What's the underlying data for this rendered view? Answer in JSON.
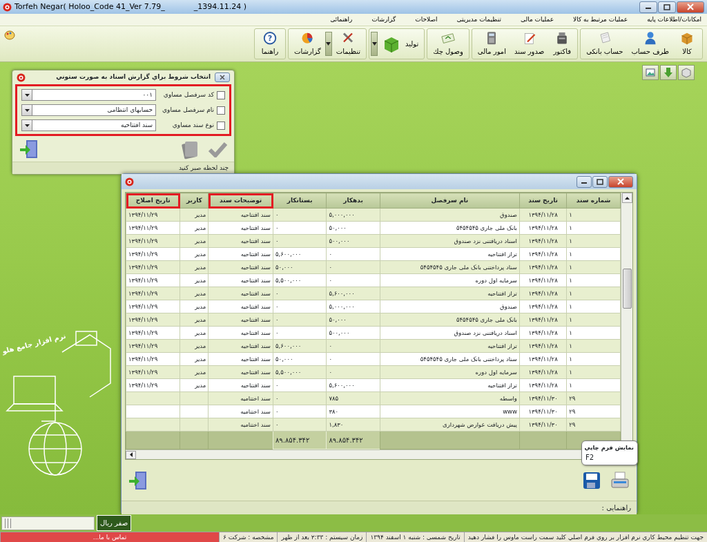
{
  "window": {
    "title": "Torfeh Negar( Holoo_Code 41_Ver 7.79_            _1394.11.24 )"
  },
  "menu": [
    "امکانات/اطلاعات پایه",
    "عملیات مرتبط به کالا",
    "عملیات مالی",
    "تنظیمات مدیریتی",
    "اصلاحات",
    "گزارشات",
    "راهنمائی"
  ],
  "toolbar": [
    [
      {
        "label": "کالا",
        "kind": "button"
      },
      {
        "label": "طرف حساب",
        "kind": "button"
      },
      {
        "label": "حساب بانکی",
        "kind": "button"
      }
    ],
    [
      {
        "label": "فاکتور",
        "kind": "button"
      },
      {
        "label": "صدور سند",
        "kind": "button"
      },
      {
        "label": "امور مالی",
        "kind": "button"
      }
    ],
    [
      {
        "label": "وصول چك",
        "kind": "button"
      }
    ],
    [
      {
        "label": "تولید",
        "kind": "dropdown"
      }
    ],
    [
      {
        "label": "تنظیمات",
        "kind": "dropdown"
      },
      {
        "label": "گزارشات",
        "kind": "button"
      }
    ],
    [
      {
        "label": "راهنما",
        "kind": "button",
        "glyph": "?"
      }
    ]
  ],
  "filter_dialog": {
    "title": "انتخاب شروط براي گزارش اسناد به صورت ستوني",
    "highlighted": true,
    "conditions": [
      {
        "label": "کد سرفصل مساوي",
        "checked": false,
        "value": "۰۰۱"
      },
      {
        "label": "نام سرفصل مساوي",
        "checked": false,
        "value": "حسابهاي انتظامی"
      },
      {
        "label": "نوع سند مساوي",
        "checked": false,
        "value": "سند افتتاحیه"
      }
    ],
    "hint": "چند لحظه صبر کنید"
  },
  "report_window": {
    "columns": [
      {
        "label": "شماره سند",
        "highlighted": false
      },
      {
        "label": "تاریخ سند",
        "highlighted": false
      },
      {
        "label": "نام سرفصل",
        "highlighted": false
      },
      {
        "label": "بدهکار",
        "highlighted": false
      },
      {
        "label": "بستانکار",
        "highlighted": false
      },
      {
        "label": "توضیحات سند",
        "highlighted": true
      },
      {
        "label": "کاربر",
        "highlighted": false
      },
      {
        "label": "تاریخ اصلاح",
        "highlighted": true
      }
    ],
    "rows": [
      [
        "۱",
        "۱۳۹۴/۱۱/۲۸",
        "صندوق",
        "۵,۰۰۰,۰۰۰",
        "۰",
        "سند افتتاحیه",
        "مدیر",
        "۱۳۹۴/۱۱/۲۹"
      ],
      [
        "۱",
        "۱۳۹۴/۱۱/۲۸",
        "بانک ملی جاری ۵۴۵۴۵۴۵",
        "۵۰,۰۰۰",
        "۰",
        "سند افتتاحیه",
        "مدیر",
        "۱۳۹۴/۱۱/۲۹"
      ],
      [
        "۱",
        "۱۳۹۴/۱۱/۲۸",
        "اسناد دریافتنی نزد صندوق",
        "۵۰۰,۰۰۰",
        "۰",
        "سند افتتاحیه",
        "مدیر",
        "۱۳۹۴/۱۱/۲۹"
      ],
      [
        "۱",
        "۱۳۹۴/۱۱/۲۸",
        "تراز افتتاحیه",
        "۰",
        "۵,۶۰۰,۰۰۰",
        "سند افتتاحیه",
        "مدیر",
        "۱۳۹۴/۱۱/۲۹"
      ],
      [
        "۱",
        "۱۳۹۴/۱۱/۲۸",
        "سناد پرداختنی بانک ملی جاری ۵۴۵۴۵۴۵",
        "۰",
        "۵۰,۰۰۰",
        "سند افتتاحیه",
        "مدیر",
        "۱۳۹۴/۱۱/۲۹"
      ],
      [
        "۱",
        "۱۳۹۴/۱۱/۲۸",
        "سرمایه اول دوره",
        "۰",
        "۵,۵۰۰,۰۰۰",
        "سند افتتاحیه",
        "مدیر",
        "۱۳۹۴/۱۱/۲۹"
      ],
      [
        "۱",
        "۱۳۹۴/۱۱/۲۸",
        "تراز افتتاحیه",
        "۵,۶۰۰,۰۰۰",
        "۰",
        "سند افتتاحیه",
        "مدیر",
        "۱۳۹۴/۱۱/۲۹"
      ],
      [
        "۱",
        "۱۳۹۴/۱۱/۲۸",
        "صندوق",
        "۵,۰۰۰,۰۰۰",
        "۰",
        "سند افتتاحیه",
        "مدیر",
        "۱۳۹۴/۱۱/۲۹"
      ],
      [
        "۱",
        "۱۳۹۴/۱۱/۲۸",
        "بانک ملی جاری ۵۴۵۴۵۴۵",
        "۵۰,۰۰۰",
        "۰",
        "سند افتتاحیه",
        "مدیر",
        "۱۳۹۴/۱۱/۲۹"
      ],
      [
        "۱",
        "۱۳۹۴/۱۱/۲۸",
        "اسناد دریافتنی نزد صندوق",
        "۵۰۰,۰۰۰",
        "۰",
        "سند افتتاحیه",
        "مدیر",
        "۱۳۹۴/۱۱/۲۹"
      ],
      [
        "۱",
        "۱۳۹۴/۱۱/۲۸",
        "تراز افتتاحیه",
        "۰",
        "۵,۶۰۰,۰۰۰",
        "سند افتتاحیه",
        "مدیر",
        "۱۳۹۴/۱۱/۲۹"
      ],
      [
        "۱",
        "۱۳۹۴/۱۱/۲۸",
        "سناد پرداختنی بانک ملی جاری ۵۴۵۴۵۴۵",
        "۰",
        "۵۰,۰۰۰",
        "سند افتتاحیه",
        "مدیر",
        "۱۳۹۴/۱۱/۲۹"
      ],
      [
        "۱",
        "۱۳۹۴/۱۱/۲۸",
        "سرمایه اول دوره",
        "۰",
        "۵,۵۰۰,۰۰۰",
        "سند افتتاحیه",
        "مدیر",
        "۱۳۹۴/۱۱/۲۹"
      ],
      [
        "۱",
        "۱۳۹۴/۱۱/۲۸",
        "تراز افتتاحیه",
        "۵,۶۰۰,۰۰۰",
        "۰",
        "سند افتتاحیه",
        "مدیر",
        "۱۳۹۴/۱۱/۲۹"
      ],
      [
        "۲۹",
        "۱۳۹۴/۱۱/۳۰",
        "واسطه",
        "۷۸۵",
        "۰",
        "سند اختتامیه",
        null,
        null
      ],
      [
        "۲۹",
        "۱۳۹۴/۱۱/۳۰",
        "www",
        "۳۸۰",
        "۰",
        "سند اختتامیه",
        null,
        null
      ],
      [
        "۲۹",
        "۱۳۹۴/۱۱/۳۰",
        "پیش دریافت عوارض شهرداری",
        "۱,۸۳۰",
        "۰",
        "سند اختتامیه",
        null,
        null
      ]
    ],
    "totals": {
      "debit": "۸۹.۸۵۴.۳۴۲",
      "credit": "۸۹.۸۵۴.۳۴۲"
    },
    "tooltip": {
      "title": "نمایش فرم چاپي",
      "shortcut": "F2"
    },
    "status": "راهنمایی :"
  },
  "side_panel": {
    "balance": "صفر ریال",
    "logo_text": "نرم افزار جامع هلو"
  },
  "status_bar": [
    {
      "text": "جهت تنظیم محیط کاري نرم افزار بر روي فرم اصلي کلید سمت راست ماوس را فشار دهید",
      "kind": "text"
    },
    {
      "text": "تاریخ شمسی : شنبه ۱ اسفند ۱۳۹۴",
      "kind": "text"
    },
    {
      "text": "زمان سیستم : ۲:۳۳ بعد از ظهر",
      "kind": "text"
    },
    {
      "text": "مشخصه : شرکت ۶",
      "kind": "text"
    },
    {
      "text": "تماس با ما...",
      "kind": "link"
    }
  ]
}
